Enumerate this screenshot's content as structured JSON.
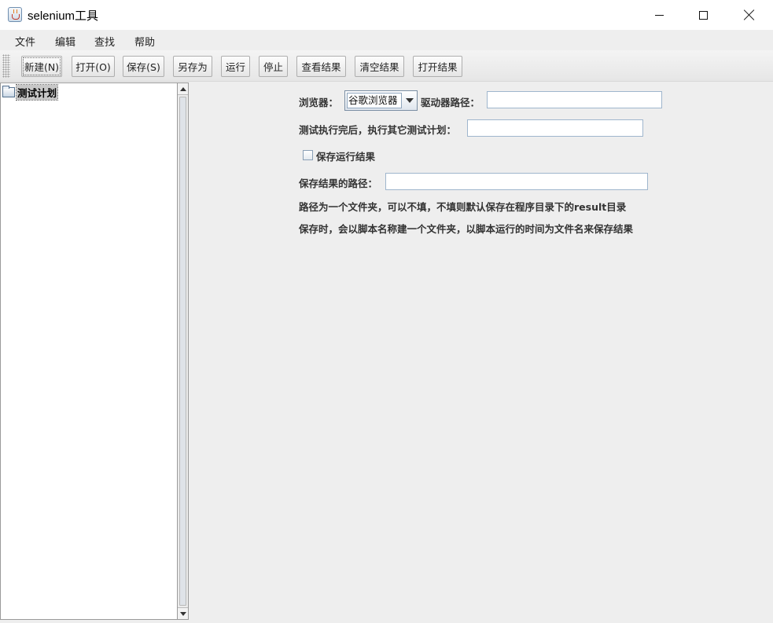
{
  "window": {
    "title": "selenium工具"
  },
  "menu": [
    "文件",
    "编辑",
    "查找",
    "帮助"
  ],
  "toolbar": {
    "buttons": [
      "新建(N)",
      "打开(O)",
      "保存(S)",
      "另存为",
      "运行",
      "停止",
      "查看结果",
      "清空结果",
      "打开结果"
    ]
  },
  "tree": {
    "root_label": "测试计划"
  },
  "config": {
    "browser_label": "浏览器：",
    "browser_value": "谷歌浏览器",
    "driver_path_label": "驱动器路径：",
    "driver_path_value": "",
    "next_plan_label": "测试执行完后，执行其它测试计划：",
    "next_plan_value": "",
    "save_result_checkbox_label": "保存运行结果",
    "save_result_checked": false,
    "result_path_label": "保存结果的路径：",
    "result_path_value": "",
    "info_line1": "路径为一个文件夹，可以不填，不填则默认保存在程序目录下的result目录",
    "info_line2": "保存时，会以脚本名称建一个文件夹，以脚本运行的时间为文件名来保存结果"
  }
}
